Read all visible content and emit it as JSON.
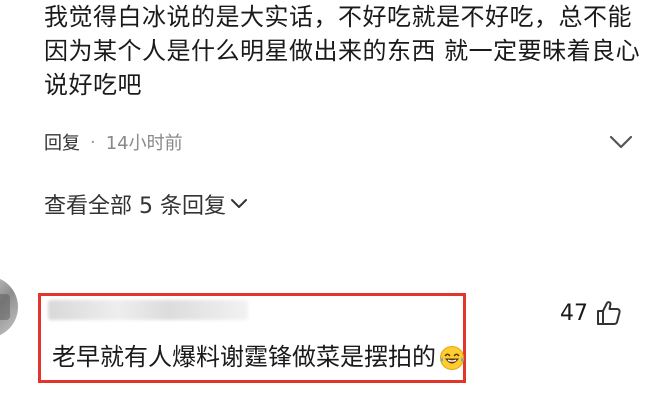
{
  "comment": {
    "text": "我觉得白冰说的是大实话，不好吃就是不好吃，总不能因为某个人是什么明星做出来的东西 就一定要昧着良心说好吃吧",
    "reply_label": "回复",
    "separator": "·",
    "time": "14小时前"
  },
  "view_all_replies": {
    "label": "查看全部 5 条回复"
  },
  "second_comment": {
    "text": "老早就有人爆料谢霆锋做菜是摆拍的",
    "like_count": "47",
    "emoji_icon": "crying-laughing-emoji"
  },
  "colors": {
    "highlight": "#e2352b",
    "text": "#1a1a1a",
    "muted": "#8a8a8a"
  }
}
